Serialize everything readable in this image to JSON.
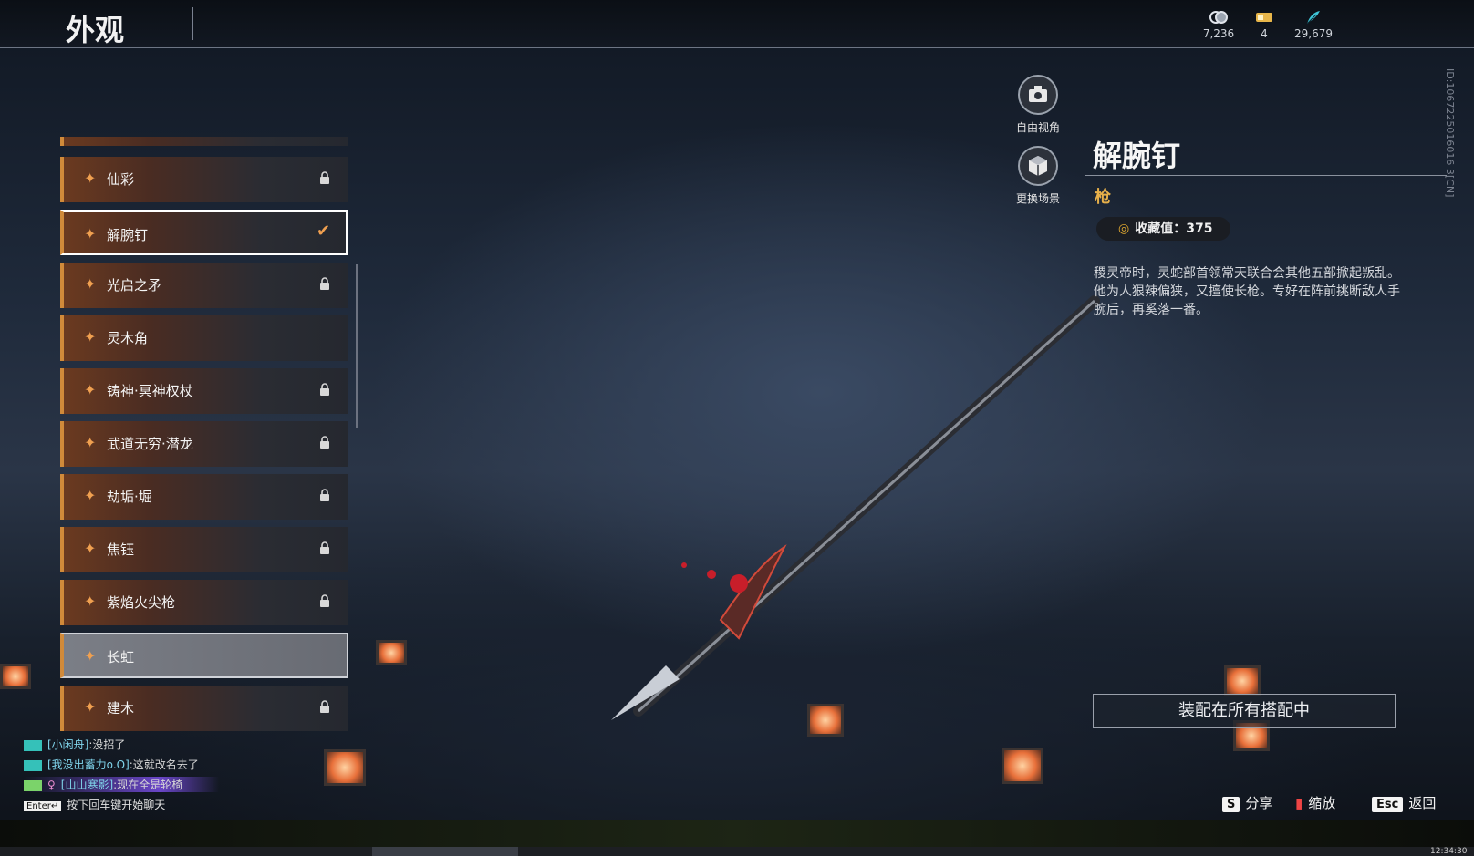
{
  "header": {
    "title": "外观",
    "currencies": [
      {
        "icon": "coins-icon",
        "value": "7,236"
      },
      {
        "icon": "ticket-icon",
        "value": "4"
      },
      {
        "icon": "feather-icon",
        "value": "29,679"
      }
    ]
  },
  "list": {
    "items": [
      {
        "label": "仙彩",
        "locked": true,
        "state": "normal"
      },
      {
        "label": "解腕钉",
        "locked": false,
        "state": "selected"
      },
      {
        "label": "光启之矛",
        "locked": true,
        "state": "normal"
      },
      {
        "label": "灵木角",
        "locked": false,
        "state": "normal"
      },
      {
        "label": "铸神·冥神权杖",
        "locked": true,
        "state": "normal"
      },
      {
        "label": "武道无穷·潜龙",
        "locked": true,
        "state": "normal"
      },
      {
        "label": "劫垢·堀",
        "locked": true,
        "state": "normal"
      },
      {
        "label": "焦钰",
        "locked": true,
        "state": "normal"
      },
      {
        "label": "紫焰火尖枪",
        "locked": true,
        "state": "normal"
      },
      {
        "label": "长虹",
        "locked": false,
        "state": "highlight"
      },
      {
        "label": "建木",
        "locked": true,
        "state": "normal"
      }
    ]
  },
  "view_buttons": {
    "free_view": "自由视角",
    "change_scene": "更换场景"
  },
  "detail": {
    "name": "解腕钉",
    "type": "枪",
    "collect_label": "收藏值：375",
    "description": "稷灵帝时，灵蛇部首领常天联合会其他五部掀起叛乱。他为人狠辣偏狭，又擅使长枪。专好在阵前挑断敌人手腕后，再奚落一番。",
    "side_id": "ID:1067225016016 3[CN]",
    "equip_button": "装配在所有搭配中"
  },
  "hints": {
    "share_key": "S",
    "share": "分享",
    "zoom": "缩放",
    "back_key": "Esc",
    "back": "返回"
  },
  "chat": {
    "lines": [
      {
        "name": "[小闲舟]",
        "text": ":没招了"
      },
      {
        "name": "[我没出蓄力o.O]",
        "text": ":这就改名去了"
      },
      {
        "name": "[山山寒影]",
        "text": ":现在全是轮椅"
      }
    ],
    "enter_key": "Enter↵",
    "hint": "按下回车键开始聊天"
  },
  "taskbar": {
    "clock": "12:34:30"
  },
  "colors": {
    "accent": "#d08a3a",
    "gold": "#e7b04a"
  }
}
